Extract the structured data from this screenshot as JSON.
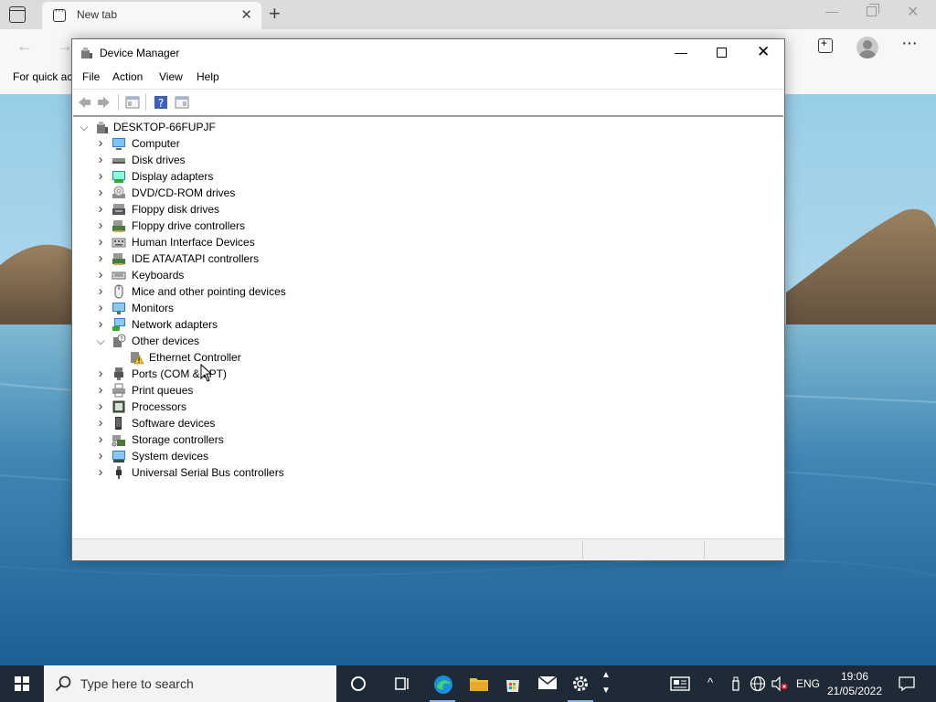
{
  "browser": {
    "tab_title": "New tab",
    "newtab_symbol": "+",
    "close_symbol": "✕",
    "min_symbol": "—",
    "back_symbol": "←",
    "fwd_symbol": "→",
    "more_symbol": "···",
    "favorites_hint": "For quick ac"
  },
  "device_manager": {
    "title": "Device Manager",
    "menu": [
      "File",
      "Action",
      "View",
      "Help"
    ],
    "min_symbol": "—",
    "close_symbol": "✕",
    "root": "DESKTOP-66FUPJF",
    "categories": [
      {
        "label": "Computer",
        "icon": "computer-icon",
        "expanded": false
      },
      {
        "label": "Disk drives",
        "icon": "disk-drive-icon",
        "expanded": false
      },
      {
        "label": "Display adapters",
        "icon": "display-adapter-icon",
        "expanded": false
      },
      {
        "label": "DVD/CD-ROM drives",
        "icon": "dvd-drive-icon",
        "expanded": false
      },
      {
        "label": "Floppy disk drives",
        "icon": "floppy-disk-icon",
        "expanded": false
      },
      {
        "label": "Floppy drive controllers",
        "icon": "floppy-controller-icon",
        "expanded": false
      },
      {
        "label": "Human Interface Devices",
        "icon": "hid-icon",
        "expanded": false
      },
      {
        "label": "IDE ATA/ATAPI controllers",
        "icon": "ide-controller-icon",
        "expanded": false
      },
      {
        "label": "Keyboards",
        "icon": "keyboard-icon",
        "expanded": false
      },
      {
        "label": "Mice and other pointing devices",
        "icon": "mouse-icon",
        "expanded": false
      },
      {
        "label": "Monitors",
        "icon": "monitor-icon",
        "expanded": false
      },
      {
        "label": "Network adapters",
        "icon": "network-adapter-icon",
        "expanded": false
      },
      {
        "label": "Other devices",
        "icon": "other-devices-icon",
        "expanded": true
      },
      {
        "label": "Ethernet Controller",
        "icon": "warning-device-icon",
        "child": true
      },
      {
        "label": "Ports (COM & LPT)",
        "icon": "port-icon",
        "expanded": false
      },
      {
        "label": "Print queues",
        "icon": "printer-icon",
        "expanded": false
      },
      {
        "label": "Processors",
        "icon": "processor-icon",
        "expanded": false
      },
      {
        "label": "Software devices",
        "icon": "software-device-icon",
        "expanded": false
      },
      {
        "label": "Storage controllers",
        "icon": "storage-controller-icon",
        "expanded": false
      },
      {
        "label": "System devices",
        "icon": "system-devices-icon",
        "expanded": false
      },
      {
        "label": "Universal Serial Bus controllers",
        "icon": "usb-icon",
        "expanded": false
      }
    ]
  },
  "taskbar": {
    "search_placeholder": "Type here to search",
    "language": "ENG",
    "time": "19:06",
    "date": "21/05/2022",
    "apps": [
      "cortana-icon",
      "task-view-icon",
      "edge-icon",
      "file-explorer-icon",
      "store-icon",
      "mail-icon",
      "settings-icon"
    ]
  }
}
